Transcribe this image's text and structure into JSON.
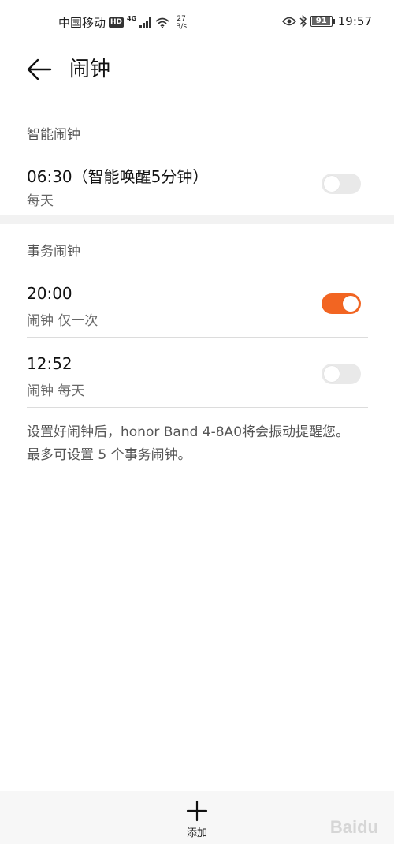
{
  "status_bar": {
    "carrier": "中国移动",
    "hd": "HD",
    "network": "4G",
    "speed_value": "27",
    "speed_unit": "B/s",
    "battery": "91",
    "time": "19:57"
  },
  "app_bar": {
    "title": "闹钟"
  },
  "smart_section": {
    "label": "智能闹钟",
    "alarm": {
      "time": "06:30（智能唤醒5分钟）",
      "repeat": "每天",
      "enabled": false
    }
  },
  "task_section": {
    "label": "事务闹钟",
    "alarms": [
      {
        "time": "20:00",
        "repeat": "闹钟 仅一次",
        "enabled": true
      },
      {
        "time": "12:52",
        "repeat": "闹钟 每天",
        "enabled": false
      }
    ]
  },
  "note": "设置好闹钟后，honor Band 4-8A0将会振动提醒您。最多可设置 5 个事务闹钟。",
  "bottom_bar": {
    "add_label": "添加"
  },
  "colors": {
    "accent": "#f26522",
    "toggle_off": "#e9e9e9"
  }
}
